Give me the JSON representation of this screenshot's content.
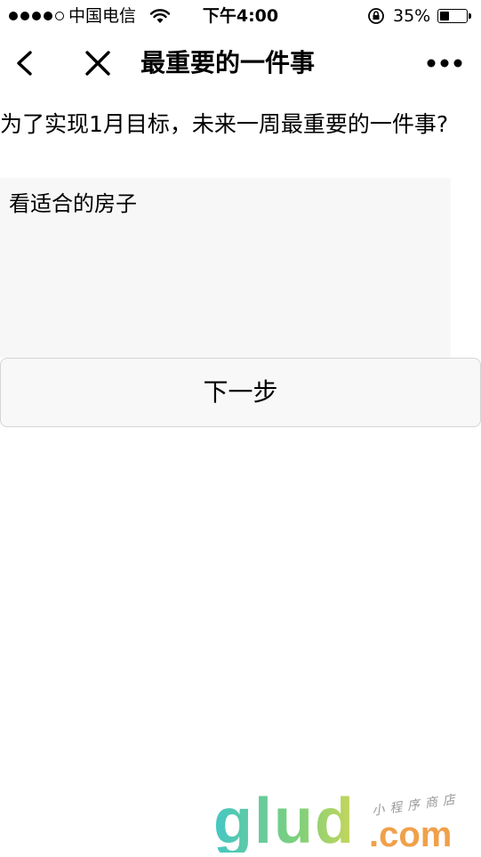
{
  "status_bar": {
    "carrier": "中国电信",
    "time": "下午4:00",
    "battery_percent": "35%",
    "battery_level": 0.35,
    "signal_bars_filled": 4,
    "signal_bars_total": 5
  },
  "nav": {
    "title": "最重要的一件事",
    "back_icon": "chevron-left-icon",
    "close_icon": "close-icon",
    "more_icon": "more-dots-icon"
  },
  "main": {
    "question": "为了实现1月目标，未来一周最重要的一件事?",
    "answer_value": "看适合的房子",
    "next_button_label": "下一步"
  },
  "watermark": {
    "logo": "glud",
    "domain": ".com",
    "tagline": "小程序商店"
  }
}
